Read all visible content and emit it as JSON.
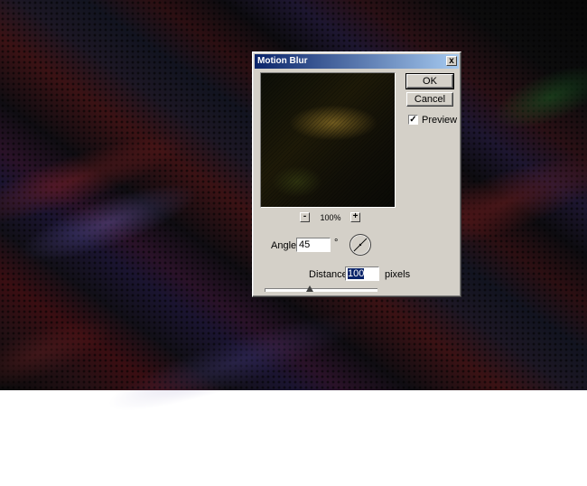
{
  "dialog": {
    "title": "Motion Blur",
    "close_glyph": "x",
    "ok_label": "OK",
    "cancel_label": "Cancel",
    "preview_checked": true,
    "preview_label": "Preview",
    "zoom_out_glyph": "-",
    "zoom_in_glyph": "+",
    "zoom_level": "100%",
    "angle_label": "Angle:",
    "angle_value": "45",
    "angle_unit": "°",
    "distance_label": "Distance:",
    "distance_value": "100",
    "distance_unit": "pixels",
    "distance_slider_fraction": 0.4
  },
  "icons": {
    "close": "close-icon",
    "checkbox": "check-icon",
    "dial": "angle-dial-icon"
  },
  "colors": {
    "titlebar_start": "#0a246a",
    "titlebar_end": "#a6caf0",
    "dialog_face": "#d4d0c8",
    "selection": "#0a246a"
  }
}
